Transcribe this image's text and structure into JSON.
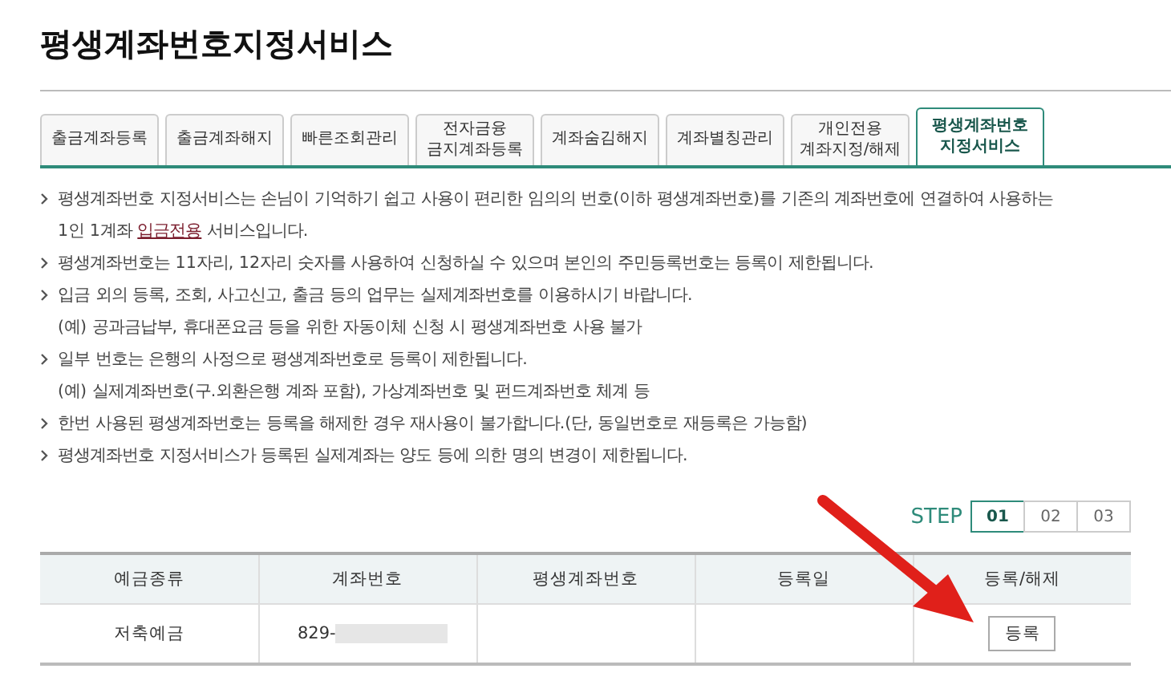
{
  "title": "평생계좌번호지정서비스",
  "tabs": [
    {
      "label": "출금계좌등록",
      "selected": false
    },
    {
      "label": "출금계좌해지",
      "selected": false
    },
    {
      "label": "빠른조회관리",
      "selected": false
    },
    {
      "label": "전자금융\n금지계좌등록",
      "selected": false
    },
    {
      "label": "계좌숨김해지",
      "selected": false
    },
    {
      "label": "계좌별칭관리",
      "selected": false
    },
    {
      "label": "개인전용\n계좌지정/해제",
      "selected": false
    },
    {
      "label": "평생계좌번호\n지정서비스",
      "selected": true
    }
  ],
  "notices": [
    {
      "kind": "bullet",
      "text": "평생계좌번호 지정서비스는 손님이 기억하기 쉽고 사용이 편리한 임의의 번호(이하 평생계좌번호)를 기존의 계좌번호에 연결하여 사용하는"
    },
    {
      "kind": "linked",
      "before": "1인 1계좌 ",
      "link": "입금전용",
      "after": " 서비스입니다."
    },
    {
      "kind": "bullet",
      "text": "평생계좌번호는 11자리, 12자리 숫자를 사용하여 신청하실 수 있으며 본인의 주민등록번호는 등록이 제한됩니다."
    },
    {
      "kind": "bullet",
      "text": "입금 외의 등록, 조회, 사고신고, 출금 등의 업무는 실제계좌번호를 이용하시기 바랍니다."
    },
    {
      "kind": "note",
      "text": "(예) 공과금납부, 휴대폰요금 등을 위한 자동이체 신청 시 평생계좌번호 사용 불가"
    },
    {
      "kind": "bullet",
      "text": "일부 번호는 은행의 사정으로 평생계좌번호로 등록이 제한됩니다."
    },
    {
      "kind": "note",
      "text": "(예) 실제계좌번호(구.외환은행 계좌 포함), 가상계좌번호 및 펀드계좌번호 체계 등"
    },
    {
      "kind": "bullet",
      "text": "한번 사용된 평생계좌번호는 등록을 해제한 경우 재사용이 불가합니다.(단, 동일번호로 재등록은 가능함)"
    },
    {
      "kind": "bullet",
      "text": "평생계좌번호 지정서비스가 등록된 실제계좌는 양도 등에 의한 명의 변경이 제한됩니다."
    }
  ],
  "steps": {
    "label": "STEP",
    "items": [
      {
        "label": "01",
        "selected": true
      },
      {
        "label": "02",
        "selected": false
      },
      {
        "label": "03",
        "selected": false
      }
    ]
  },
  "table": {
    "columns": [
      "예금종류",
      "계좌번호",
      "평생계좌번호",
      "등록일",
      "등록/해제"
    ],
    "rows": [
      {
        "type": "저축예금",
        "account": "829-",
        "button": "등록"
      }
    ]
  }
}
